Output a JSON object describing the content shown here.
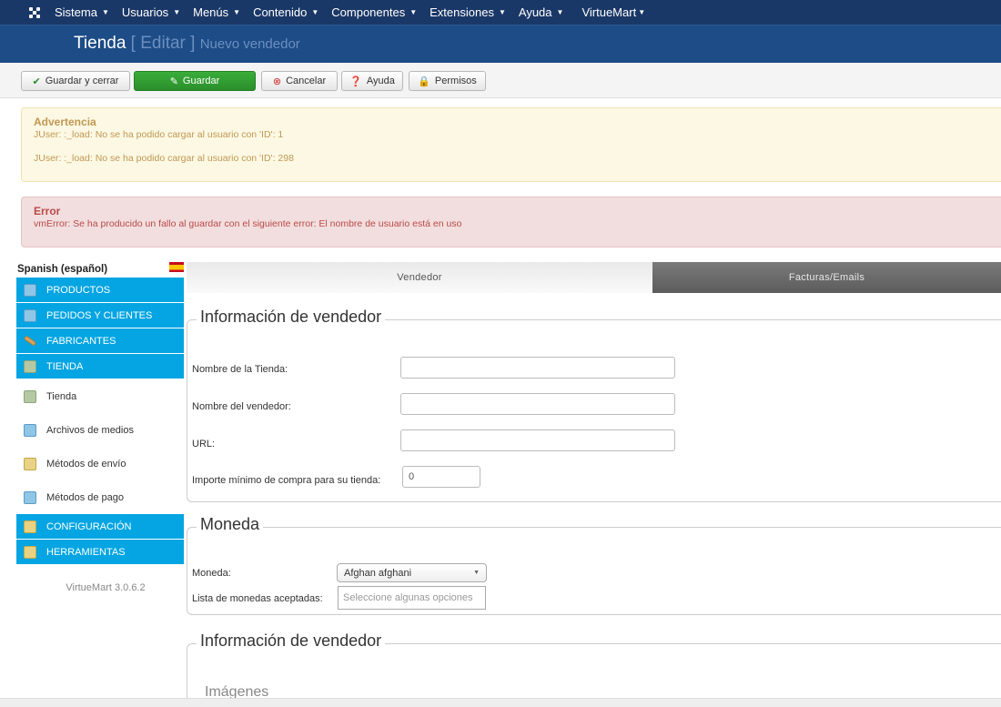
{
  "menu": {
    "items": [
      "Sistema",
      "Usuarios",
      "Menús",
      "Contenido",
      "Componentes",
      "Extensiones",
      "Ayuda",
      "VirtueMart"
    ]
  },
  "title": {
    "main": "Tienda",
    "action": "Editar",
    "subtitle": "Nuevo vendedor",
    "bracket_open": "[",
    "bracket_close": "]"
  },
  "toolbar": {
    "save_close": "Guardar y cerrar",
    "save": "Guardar",
    "cancel": "Cancelar",
    "help": "Ayuda",
    "permissions": "Permisos"
  },
  "alerts": {
    "warning": {
      "heading": "Advertencia",
      "messages": [
        "JUser: :_load: No se ha podido cargar al usuario con 'ID': 1",
        "JUser: :_load: No se ha podido cargar al usuario con 'ID': 298"
      ]
    },
    "error": {
      "heading": "Error",
      "message": "vmError: Se ha producido un fallo al guardar con el siguiente error: El nombre de usuario está en uso"
    }
  },
  "sidebar": {
    "language": "Spanish (español)",
    "items": [
      {
        "label": "PRODUCTOS"
      },
      {
        "label": "PEDIDOS Y CLIENTES"
      },
      {
        "label": "FABRICANTES"
      },
      {
        "label": "TIENDA"
      },
      {
        "label": "Tienda"
      },
      {
        "label": "Archivos de medios"
      },
      {
        "label": "Métodos de envío"
      },
      {
        "label": "Métodos de pago"
      },
      {
        "label": "CONFIGURACIÓN"
      },
      {
        "label": "HERRAMIENTAS"
      }
    ],
    "version": "VirtueMart 3.0.6.2"
  },
  "tabs": [
    "Vendedor",
    "Facturas/Emails"
  ],
  "vendor_info": {
    "legend": "Información de vendedor",
    "fields": {
      "store_name_label": "Nombre de la Tienda:",
      "store_name_value": "",
      "vendor_name_label": "Nombre del vendedor:",
      "vendor_name_value": "",
      "url_label": "URL:",
      "url_value": "",
      "min_purchase_label": "Importe mínimo de compra para su tienda:",
      "min_purchase_value": "0"
    }
  },
  "currency": {
    "legend": "Moneda",
    "currency_label": "Moneda:",
    "currency_value": "Afghan afghani",
    "accepted_label": "Lista de monedas aceptadas:",
    "accepted_placeholder": "Seleccione algunas opciones"
  },
  "vendor_info2": {
    "legend": "Información de vendedor",
    "images_legend": "Imágenes"
  }
}
